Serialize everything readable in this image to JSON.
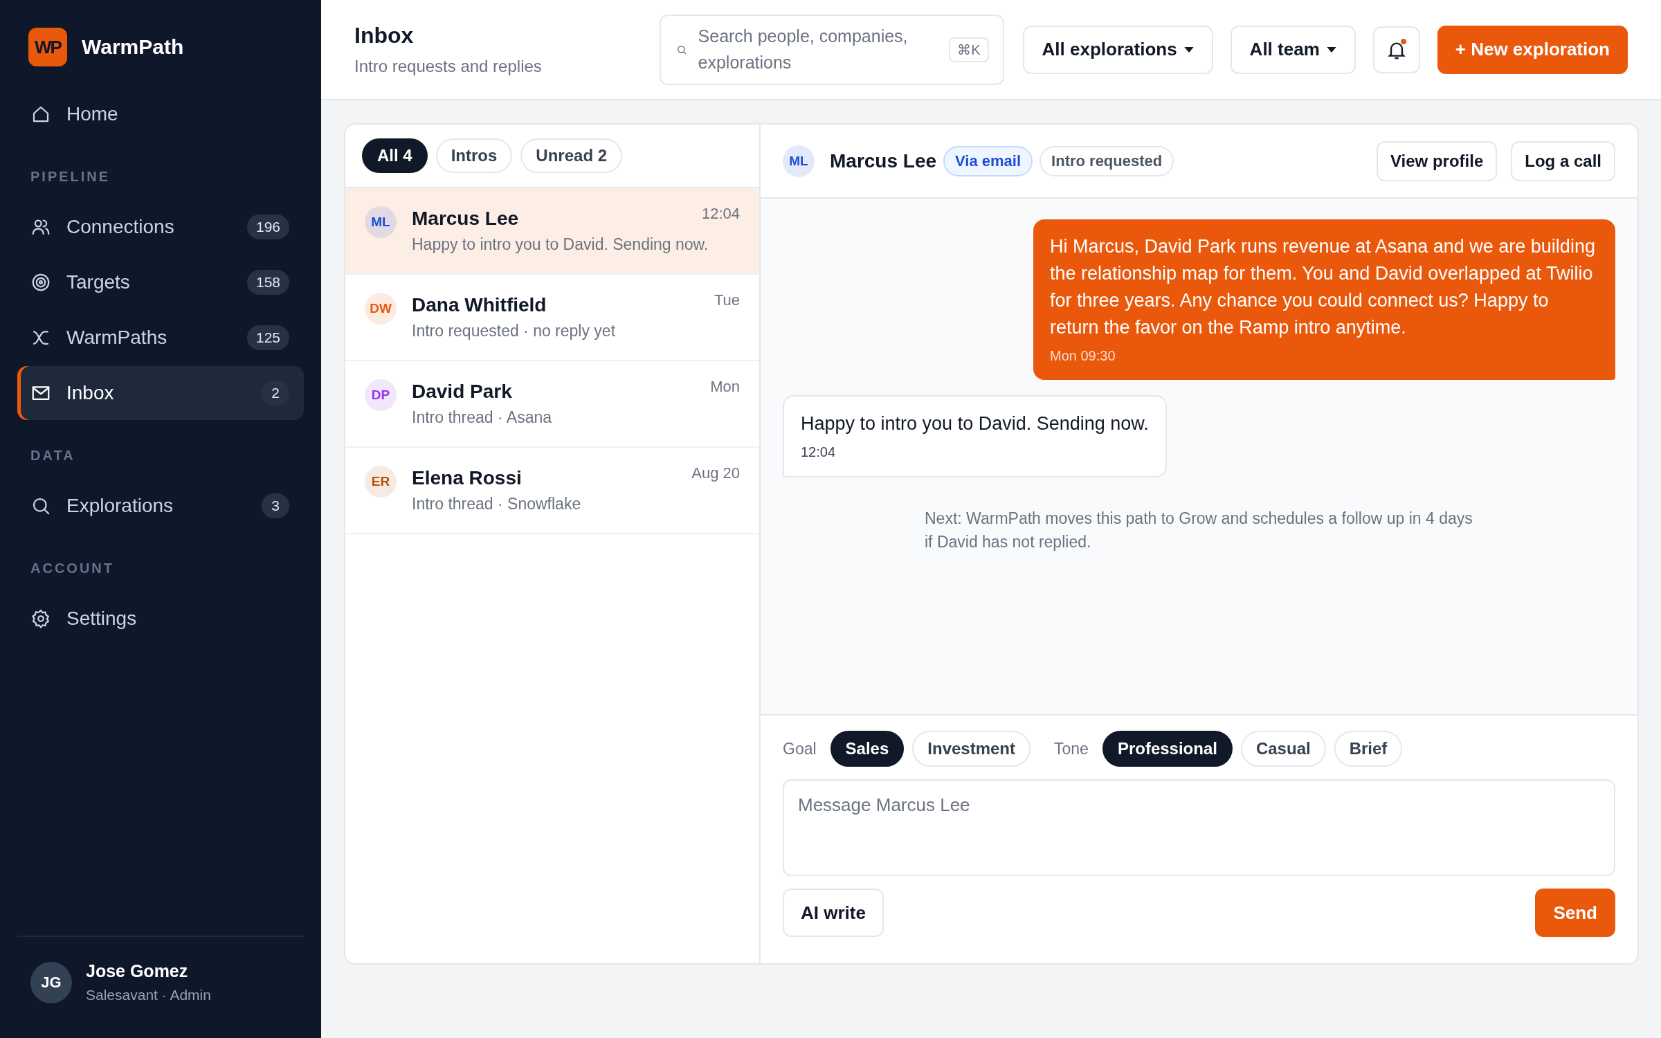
{
  "sidebar": {
    "logo": "WP",
    "app_name": "WarmPath",
    "sections": [
      {
        "items": [
          {
            "label": "Home",
            "selected": false
          }
        ]
      },
      {
        "label": "PIPELINE",
        "items": [
          {
            "label": "Connections",
            "count": "196",
            "selected": false
          },
          {
            "label": "Targets",
            "count": "158",
            "selected": false
          },
          {
            "label": "WarmPaths",
            "count": "125",
            "selected": false
          },
          {
            "label": "Inbox",
            "count": "2",
            "selected": true
          }
        ]
      },
      {
        "label": "DATA",
        "items": [
          {
            "label": "Explorations",
            "count": "3",
            "selected": false
          }
        ]
      },
      {
        "label": "ACCOUNT",
        "items": [
          {
            "label": "Settings",
            "selected": false
          }
        ]
      }
    ],
    "user": {
      "initials": "JG",
      "name": "Jose Gomez",
      "detail": "Salesavant · Admin"
    }
  },
  "header": {
    "title": "Inbox",
    "subtitle": "Intro requests and replies",
    "search": {
      "placeholder": "Search people, companies, explorations",
      "shortcut": "⌘K"
    },
    "dropdowns": [
      "All explorations",
      "All team"
    ],
    "notification": {
      "unread": true
    },
    "primary_button": "+ New exploration"
  },
  "inbox": {
    "filters": [
      {
        "label": "All 4",
        "selected": true
      },
      {
        "label": "Intros",
        "selected": false
      },
      {
        "label": "Unread 2",
        "selected": false
      }
    ],
    "threads": [
      {
        "initials": "ML",
        "color": "#1d4ed8",
        "name": "Marcus Lee",
        "time": "12:04",
        "preview": "Happy to intro you to David. Sending now.",
        "selected": true
      },
      {
        "initials": "DW",
        "color": "#ea580c",
        "name": "Dana Whitfield",
        "time": "Tue",
        "preview": "Intro requested · no reply yet",
        "selected": false
      },
      {
        "initials": "DP",
        "color": "#9333ea",
        "name": "David Park",
        "time": "Mon",
        "preview": "Intro thread · Asana",
        "selected": false
      },
      {
        "initials": "ER",
        "color": "#b45309",
        "name": "Elena Rossi",
        "time": "Aug 20",
        "preview": "Intro thread · Snowflake",
        "selected": false
      }
    ]
  },
  "conversation": {
    "initials": "ML",
    "color": "#1d4ed8",
    "name": "Marcus Lee",
    "tags": [
      {
        "label": "Via email",
        "kind": "channel"
      },
      {
        "label": "Intro requested",
        "kind": "status"
      }
    ],
    "actions": [
      "View profile",
      "Log a call"
    ],
    "messages": [
      {
        "kind": "outgoing",
        "text": "Hi Marcus, David Park runs revenue at Asana and we are building the relationship map for them. You and David overlapped at Twilio for three years. Any chance you could connect us? Happy to return the favor on the Ramp intro anytime.",
        "time": "Mon 09:30"
      },
      {
        "kind": "incoming",
        "text": "Happy to intro you to David. Sending now.",
        "time": "12:04"
      }
    ],
    "note": "Next: WarmPath moves this path to Grow and schedules a follow up in 4 days if David has not replied.",
    "compose": {
      "goal_label": "Goal",
      "goals": [
        {
          "label": "Sales",
          "selected": true
        },
        {
          "label": "Investment",
          "selected": false
        }
      ],
      "tone_label": "Tone",
      "tones": [
        {
          "label": "Professional",
          "selected": true
        },
        {
          "label": "Casual",
          "selected": false
        },
        {
          "label": "Brief",
          "selected": false
        }
      ],
      "placeholder": "Message Marcus Lee",
      "ai_button": "AI write",
      "send_button": "Send"
    }
  }
}
